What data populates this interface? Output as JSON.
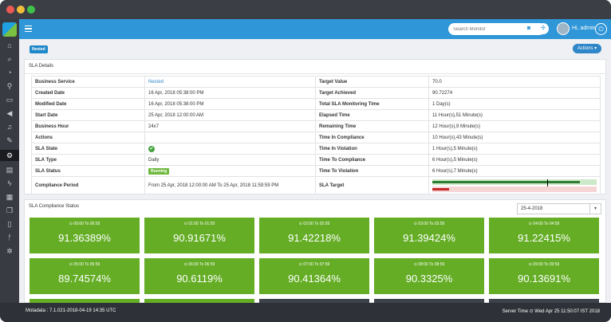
{
  "topbar": {
    "search_placeholder": "Search Monitor",
    "user": "Hi, admin"
  },
  "page": {
    "tag": "Nested",
    "actions_label": "Actions ▾"
  },
  "sla": {
    "title": "SLA Details",
    "left": [
      {
        "label": "Business Service",
        "value": "Nested",
        "link": true
      },
      {
        "label": "Created Date",
        "value": "16 Apr, 2018 05:38:00 PM"
      },
      {
        "label": "Modified Date",
        "value": "16 Apr, 2018 05:38:00 PM"
      },
      {
        "label": "Start Date",
        "value": "25 Apr, 2018 12:00:00 AM"
      },
      {
        "label": "Business Hour",
        "value": "24x7"
      },
      {
        "label": "Actions",
        "value": ""
      },
      {
        "label": "SLA State",
        "value": "✔"
      },
      {
        "label": "SLA Type",
        "value": "Daily"
      },
      {
        "label": "SLA Status",
        "value": "Running"
      },
      {
        "label": "Compliance Period",
        "value": "From 25 Apr, 2018 12:00:00 AM To 25 Apr, 2018 11:59:59 PM"
      }
    ],
    "right": [
      {
        "label": "Target Value",
        "value": "70.0"
      },
      {
        "label": "Target Achieved",
        "value": "90.72274"
      },
      {
        "label": "Total SLA Monitoring Time",
        "value": "1 Day(s)"
      },
      {
        "label": "Elapsed Time",
        "value": "11 Hour(s),51 Minute(s)"
      },
      {
        "label": "Remaining Time",
        "value": "12 Hour(s),9 Minute(s)"
      },
      {
        "label": "Time In Compliance",
        "value": "10 Hour(s),43 Minute(s)"
      },
      {
        "label": "Time In Violation",
        "value": "1 Hour(s),5 Minute(s)"
      },
      {
        "label": "Time To Compliance",
        "value": "6 Hour(s),5 Minute(s)"
      },
      {
        "label": "Time To Violation",
        "value": "6 Hour(s),7 Minute(s)"
      },
      {
        "label": "SLA Target",
        "value": ""
      }
    ],
    "target_bar": {
      "achieved_fraction": 0.9,
      "target_fraction": 0.7,
      "violation_fraction": 0.1
    }
  },
  "compliance": {
    "title": "SLA Compliance Status",
    "date": "25-4-2018",
    "tiles": [
      {
        "time": "⊙ 00:00 To 00:59",
        "pct": "91.36389%"
      },
      {
        "time": "⊙ 01:00 To 01:59",
        "pct": "90.91671%"
      },
      {
        "time": "⊙ 02:00 To 02:59",
        "pct": "91.42218%"
      },
      {
        "time": "⊙ 03:00 To 03:59",
        "pct": "91.39424%"
      },
      {
        "time": "⊙ 04:00 To 04:59",
        "pct": "91.22415%"
      },
      {
        "time": "⊙ 05:00 To 05:59",
        "pct": "89.74574%"
      },
      {
        "time": "⊙ 06:00 To 06:59",
        "pct": "90.6119%"
      },
      {
        "time": "⊙ 07:00 To 07:59",
        "pct": "90.41364%"
      },
      {
        "time": "⊙ 08:00 To 08:59",
        "pct": "90.3325%"
      },
      {
        "time": "⊙ 09:00 To 09:59",
        "pct": "90.13691%"
      }
    ]
  },
  "footer": {
    "left": "Motadata : 7.1.021-2018-04-19 14:35 UTC",
    "right": "Server Time ⊙ Wed Apr 25 11:50:07 IST 2018"
  },
  "colors": {
    "accent": "#2f96d8",
    "tile_green": "#64ad25",
    "sidebar": "#383b42"
  }
}
